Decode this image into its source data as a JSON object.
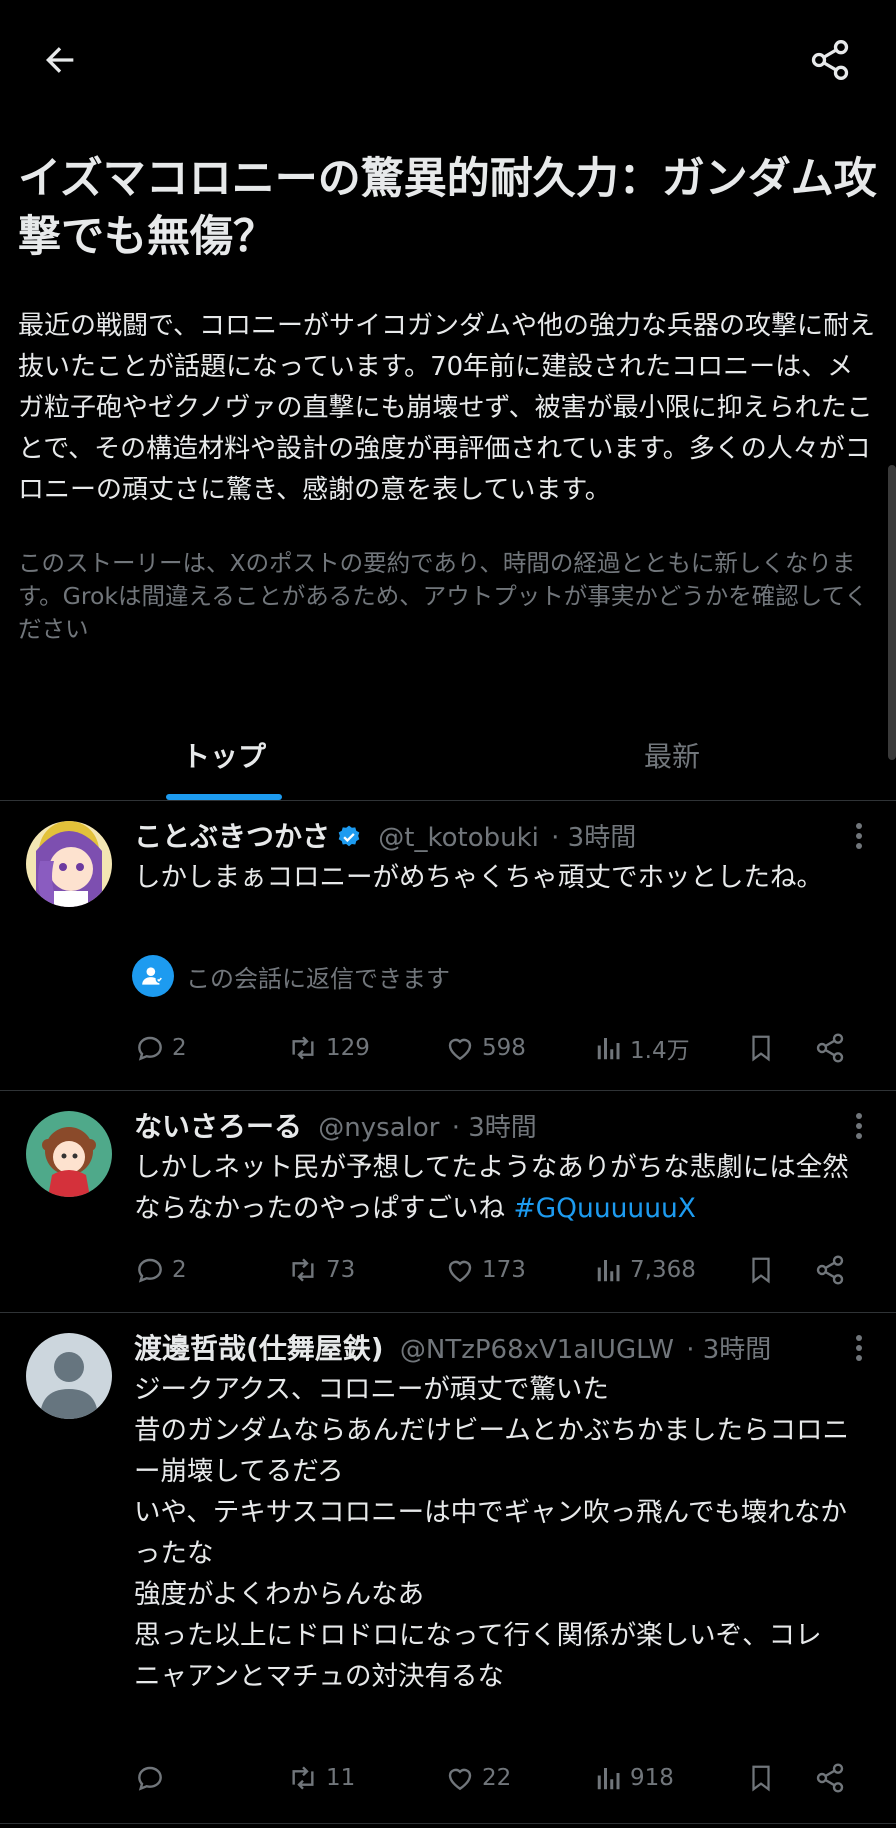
{
  "nav": {
    "back_icon": "arrow-left-icon",
    "share_icon": "share-icon"
  },
  "story": {
    "title": "イズマコロニーの驚異的耐久力：ガンダム攻撃でも無傷？",
    "summary": "最近の戦闘で、コロニーがサイコガンダムや他の強力な兵器の攻撃に耐え抜いたことが話題になっています。70年前に建設されたコロニーは、メガ粒子砲やゼクノヴァの直撃にも崩壊せず、被害が最小限に抑えられたことで、その構造材料や設計の強度が再評価されています。多くの人々がコロニーの頑丈さに驚き、感謝の意を表しています。",
    "disclaimer": "このストーリーは、Xのポストの要約であり、時間の経過とともに新しくなります。Grokは間違えることがあるため、アウトプットが事実かどうかを確認してください"
  },
  "tabs": [
    {
      "label": "トップ",
      "selected": true
    },
    {
      "label": "最新",
      "selected": false
    }
  ],
  "accent_color": "#1d9bf0",
  "posts": [
    {
      "name": "ことぶきつかさ",
      "verified": true,
      "handle": "@t_kotobuki",
      "time": "· 3時間",
      "text": "しかしまぁコロニーがめちゃくちゃ頑丈でホッとしたね。",
      "hashtag": "",
      "reply_notice": "この会話に返信できます",
      "replies": "2",
      "reposts": "129",
      "likes": "598",
      "views": "1.4万"
    },
    {
      "name": "ないさろーる",
      "verified": false,
      "handle": "@nysalor",
      "time": "· 3時間",
      "text": "しかしネット民が予想してたようなありがちな悲劇には全然ならなかったのやっぱすごいね ",
      "hashtag": "#GQuuuuuuX",
      "replies": "2",
      "reposts": "73",
      "likes": "173",
      "views": "7,368"
    },
    {
      "name": "渡邊哲哉(仕舞屋鉄)",
      "verified": false,
      "handle": "@NTzP68xV1aIUGLW",
      "time": "· 3時間",
      "text": "ジークアクス、コロニーが頑丈で驚いた\n昔のガンダムならあんだけビームとかぶちかましたらコロニー崩壊してるだろ\nいや、テキサスコロニーは中でギャン吹っ飛んでも壊れなかったな\n強度がよくわからんなあ\n思った以上にドロドロになって行く関係が楽しいぞ、コレ\nニャアンとマチュの対決有るな",
      "hashtag": "",
      "replies": "",
      "reposts": "11",
      "likes": "22",
      "views": "918"
    }
  ]
}
